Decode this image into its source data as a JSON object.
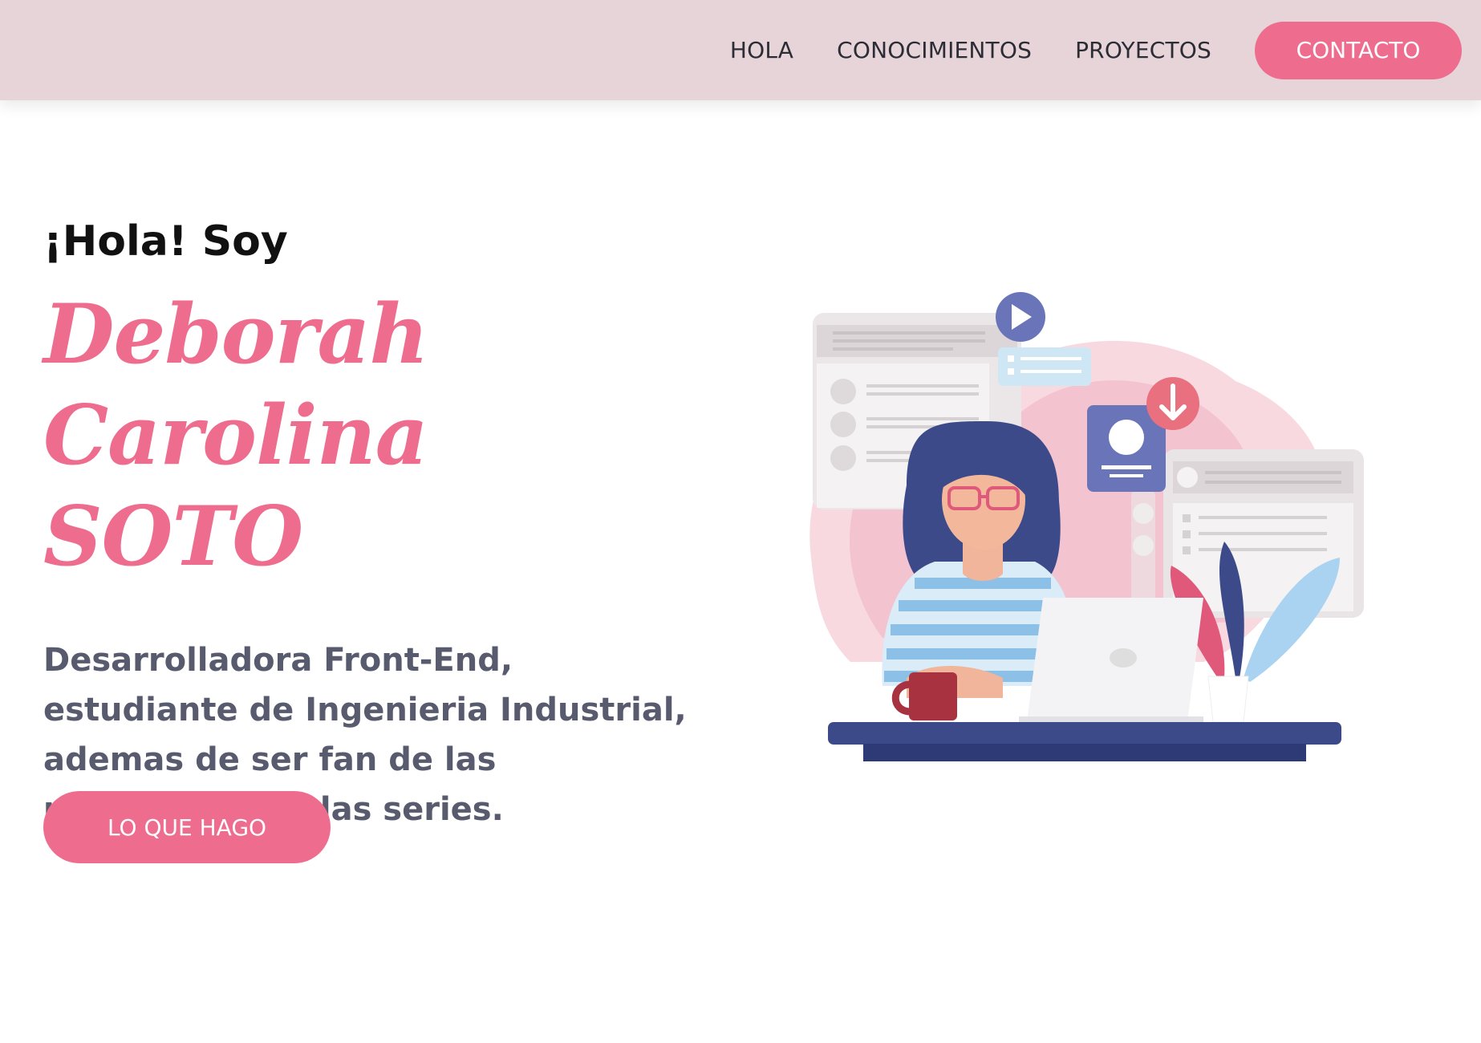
{
  "nav": {
    "links": [
      "HOLA",
      "CONOCIMIENTOS",
      "PROYECTOS"
    ],
    "cta": "CONTACTO"
  },
  "hero": {
    "greeting": "¡Hola! Soy",
    "name_line1": "Deborah Carolina",
    "name_line2": "SOTO",
    "description_lines": [
      "Desarrolladora Front-End,",
      "estudiante de Ingenieria Industrial,",
      "ademas de ser fan de las",
      "matematicas y las series."
    ],
    "button": "LO QUE HAGO"
  },
  "colors": {
    "accent": "#ee6d8e",
    "navbar": "#e6d4d9",
    "text_dark": "#111111",
    "text_muted": "#585a6e",
    "illustration_navy": "#3d4a8a"
  }
}
